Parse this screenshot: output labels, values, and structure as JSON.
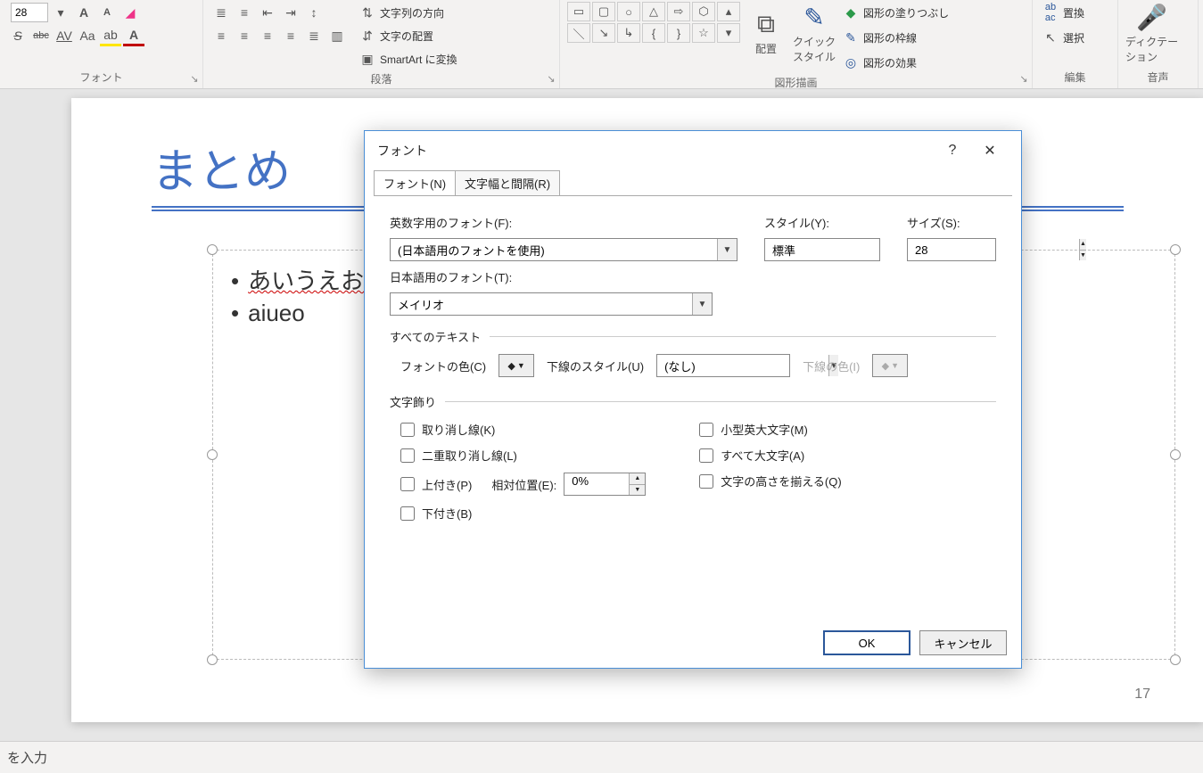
{
  "ribbon": {
    "fontsize": "28",
    "groups": {
      "font": "フォント",
      "paragraph": "段落",
      "drawing": "図形描画",
      "editing": "編集",
      "voice": "音声"
    },
    "text_align_label": "文字の配置",
    "smartart_label": "SmartArt に変換",
    "arrange_label": "配置",
    "quickstyle_label": "クイック\nスタイル",
    "shape_fill": "図形の塗りつぶし",
    "shape_outline": "図形の枠線",
    "shape_effects": "図形の効果",
    "replace": "置換",
    "select": "選択",
    "dictation": "ディクテー\nション"
  },
  "slide": {
    "title": "まとめ",
    "bullets": [
      "あいうえお",
      "aiueo"
    ],
    "page": "17"
  },
  "dialog": {
    "title": "フォント",
    "tab_font": "フォント(N)",
    "tab_spacing": "文字幅と間隔(R)",
    "latin_label": "英数字用のフォント(F):",
    "latin_value": "(日本語用のフォントを使用)",
    "style_label": "スタイル(Y):",
    "style_value": "標準",
    "size_label": "サイズ(S):",
    "size_value": "28",
    "asian_label": "日本語用のフォント(T):",
    "asian_value": "メイリオ",
    "alltext": "すべてのテキスト",
    "fontcolor": "フォントの色(C)",
    "ul_style": "下線のスタイル(U)",
    "ul_value": "(なし)",
    "ul_color": "下線の色(I)",
    "decorations": "文字飾り",
    "strike": "取り消し線(K)",
    "dstrike": "二重取り消し線(L)",
    "super": "上付き(P)",
    "sub": "下付き(B)",
    "offset_label": "相対位置(E):",
    "offset_value": "0%",
    "smallcaps": "小型英大文字(M)",
    "allcaps": "すべて大文字(A)",
    "equalize": "文字の高さを揃える(Q)",
    "ok": "OK",
    "cancel": "キャンセル"
  },
  "status": {
    "input": "を入力"
  }
}
